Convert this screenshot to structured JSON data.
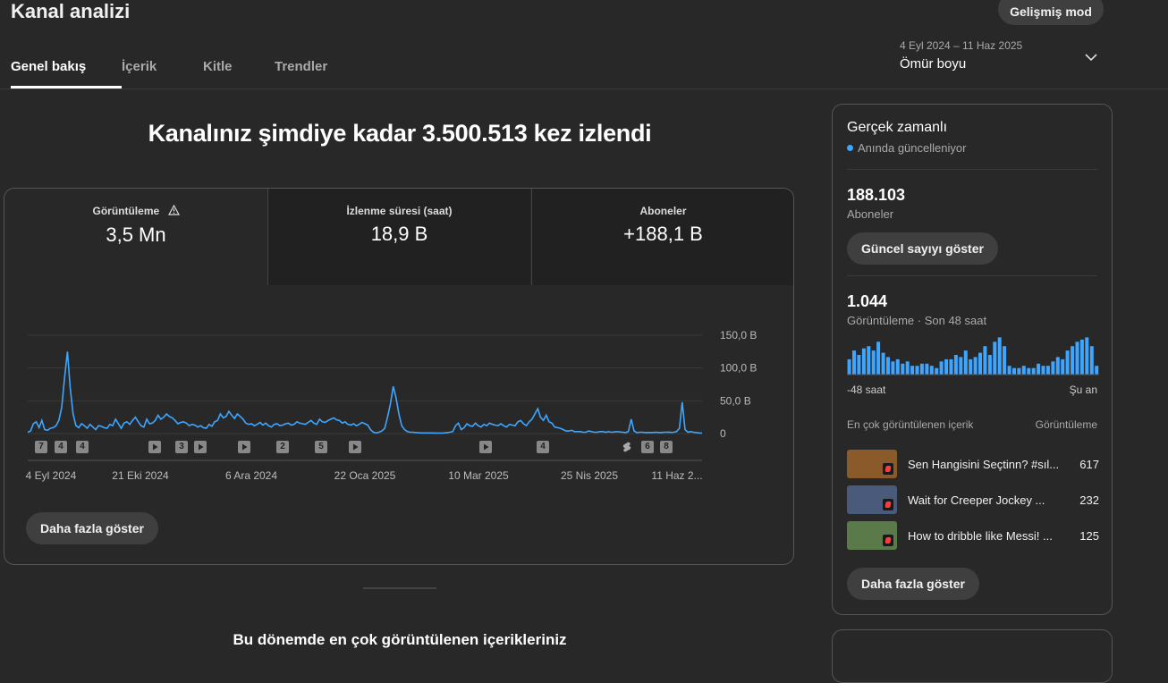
{
  "header": {
    "title": "Kanal analizi",
    "advanced_mode": "Gelişmiş mod"
  },
  "tabs": [
    {
      "label": "Genel bakış"
    },
    {
      "label": "İçerik"
    },
    {
      "label": "Kitle"
    },
    {
      "label": "Trendler"
    }
  ],
  "date_picker": {
    "range": "4 Eyl 2024 – 11 Haz 2025",
    "label": "Ömür boyu"
  },
  "main": {
    "headline": "Kanalınız şimdiye kadar 3.500.513 kez izlendi",
    "metrics": [
      {
        "label": "Görüntüleme",
        "value": "3,5 Mn"
      },
      {
        "label": "İzlenme süresi (saat)",
        "value": "18,9 B"
      },
      {
        "label": "Aboneler",
        "value": "+188,1 B"
      }
    ],
    "show_more": "Daha fazla göster",
    "bottom_heading": "Bu dönemde en çok görüntülenen içerikleriniz"
  },
  "chart_data": {
    "type": "line",
    "x_tick_labels": [
      "4 Eyl 2024",
      "21 Eki 2024",
      "6 Ara 2024",
      "22 Oca 2025",
      "10 Mar 2025",
      "25 Nis 2025",
      "11 Haz 2..."
    ],
    "y_tick_labels": [
      "150,0 B",
      "100,0 B",
      "50,0 B",
      "0"
    ],
    "ylim": [
      0,
      150000
    ],
    "color": "#3ea6ff",
    "values": [
      2000,
      4000,
      15000,
      18000,
      9000,
      20000,
      6000,
      5000,
      8000,
      9000,
      12000,
      20000,
      40000,
      85000,
      125000,
      70000,
      30000,
      12000,
      9000,
      15000,
      12000,
      8000,
      14000,
      10000,
      6000,
      12000,
      11000,
      9000,
      8000,
      14000,
      12000,
      22000,
      15000,
      8000,
      16000,
      18000,
      14000,
      20000,
      25000,
      18000,
      12000,
      10000,
      22000,
      15000,
      16000,
      20000,
      28000,
      22000,
      25000,
      30000,
      26000,
      24000,
      20000,
      15000,
      17000,
      18000,
      16000,
      12000,
      14000,
      13000,
      10000,
      12000,
      9000,
      8000,
      14000,
      11000,
      18000,
      20000,
      30000,
      24000,
      26000,
      34000,
      28000,
      23000,
      30000,
      26000,
      22000,
      16000,
      14000,
      15000,
      12000,
      14000,
      17000,
      13000,
      16000,
      12000,
      10000,
      14000,
      15000,
      12000,
      13000,
      15000,
      16000,
      13000,
      14000,
      18000,
      16000,
      15000,
      14000,
      17000,
      20000,
      16000,
      14000,
      22000,
      18000,
      17000,
      20000,
      22000,
      24000,
      21000,
      20000,
      16000,
      18000,
      14000,
      13000,
      15000,
      12000,
      14000,
      17000,
      15000,
      13000,
      6000,
      2000,
      1000,
      2000,
      4000,
      8000,
      25000,
      45000,
      72000,
      55000,
      30000,
      12000,
      6000,
      3000,
      2000,
      2000,
      1500,
      1200,
      1000,
      1000,
      1000,
      1000,
      1000,
      800,
      800,
      800,
      1000,
      1500,
      2000,
      3000,
      12000,
      16000,
      6000,
      9000,
      15000,
      12000,
      11000,
      16000,
      12000,
      10000,
      14000,
      12000,
      16000,
      14000,
      13000,
      12000,
      15000,
      12000,
      10000,
      14000,
      13000,
      12000,
      18000,
      20000,
      15000,
      12000,
      18000,
      22000,
      30000,
      38000,
      25000,
      20000,
      28000,
      18000,
      16000,
      10000,
      9000,
      8000,
      6000,
      4000,
      4000,
      5000,
      3000,
      3000,
      3000,
      2000,
      2000,
      4000,
      3000,
      2000,
      2000,
      3000,
      3000,
      2000,
      3000,
      2000,
      2500,
      3000,
      2500,
      2000,
      1500,
      3000,
      22000,
      4000,
      1500,
      2000,
      2000,
      1500,
      1800,
      1500,
      1800,
      2000,
      1500,
      1800,
      2000,
      2200,
      1800,
      2000,
      3000,
      8000,
      48000,
      6000,
      2000,
      3000,
      2000,
      1500,
      1000,
      800
    ],
    "markers": [
      "7",
      "4",
      "4",
      "play",
      "3",
      "play",
      "play",
      "2",
      "5",
      "play",
      "play",
      "4",
      "shorts",
      "6",
      "8"
    ]
  },
  "realtime": {
    "title": "Gerçek zamanlı",
    "subtitle": "Anında güncelleniyor",
    "subscribers_value": "188.103",
    "subscribers_label": "Aboneler",
    "show_count_button": "Güncel sayıyı göster",
    "views_value": "1.044",
    "views_label": "Görüntüleme · Son 48 saat",
    "axis_left": "-48 saat",
    "axis_right": "Şu an",
    "bar_values": [
      14,
      22,
      18,
      24,
      26,
      22,
      30,
      20,
      16,
      12,
      14,
      10,
      12,
      8,
      8,
      10,
      10,
      8,
      6,
      12,
      14,
      14,
      18,
      16,
      22,
      14,
      16,
      20,
      26,
      18,
      30,
      34,
      26,
      8,
      6,
      6,
      8,
      6,
      6,
      10,
      8,
      8,
      12,
      16,
      14,
      22,
      26,
      30,
      32,
      34,
      26,
      8
    ],
    "bar_color": "#3ea6ff",
    "top_content_label": "En çok görüntülenen içerik",
    "top_content_col": "Görüntüleme",
    "top_items": [
      {
        "title": "Sen Hangisini Seçtinn? #sıl...",
        "value": "617",
        "thumb_color": "#8a5a2a"
      },
      {
        "title": "Wait for Creeper Jockey ...",
        "value": "232",
        "thumb_color": "#4a5a7a"
      },
      {
        "title": "How to dribble like Messi! ...",
        "value": "125",
        "thumb_color": "#5a7a4a"
      }
    ],
    "show_more": "Daha fazla göster"
  }
}
